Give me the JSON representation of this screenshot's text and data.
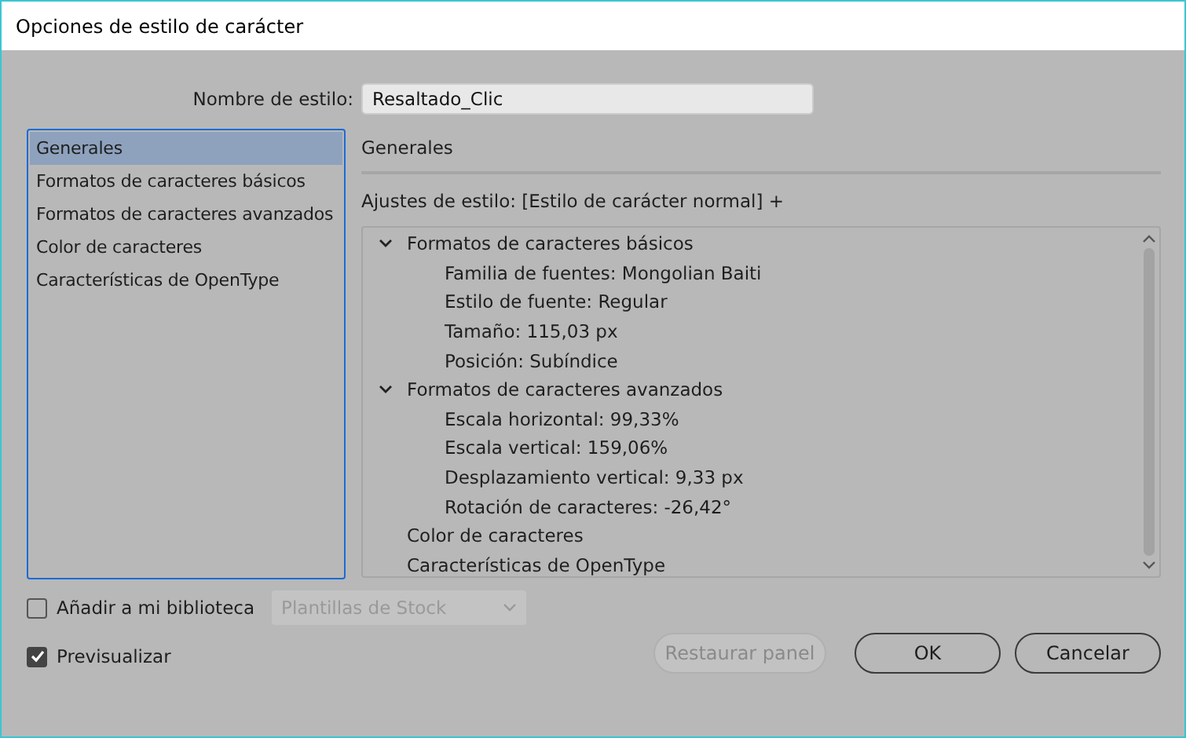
{
  "window": {
    "title": "Opciones de estilo de carácter"
  },
  "style_name": {
    "label": "Nombre de estilo:",
    "value": "Resaltado_Clic"
  },
  "sidebar": {
    "items": [
      {
        "label": "Generales",
        "selected": true
      },
      {
        "label": "Formatos de caracteres básicos",
        "selected": false
      },
      {
        "label": "Formatos de caracteres avanzados",
        "selected": false
      },
      {
        "label": "Color de caracteres",
        "selected": false
      },
      {
        "label": "Características de OpenType",
        "selected": false
      }
    ]
  },
  "panel": {
    "heading": "Generales",
    "settings": "Ajustes de estilo: [Estilo de carácter normal] +",
    "tree": [
      {
        "label": "Formatos de caracteres básicos",
        "expanded": true,
        "children": [
          {
            "label": "Familia de fuentes: Mongolian Baiti"
          },
          {
            "label": "Estilo de fuente: Regular"
          },
          {
            "label": "Tamaño: 115,03 px"
          },
          {
            "label": "Posición: Subíndice"
          }
        ]
      },
      {
        "label": "Formatos de caracteres avanzados",
        "expanded": true,
        "children": [
          {
            "label": "Escala horizontal: 99,33%"
          },
          {
            "label": "Escala vertical: 159,06%"
          },
          {
            "label": "Desplazamiento vertical: 9,33 px"
          },
          {
            "label": "Rotación de caracteres: -26,42°"
          }
        ]
      },
      {
        "label": "Color de caracteres"
      },
      {
        "label": "Características de OpenType"
      }
    ]
  },
  "library": {
    "label": "Añadir a mi biblioteca",
    "checked": false,
    "dropdown": "Plantillas de Stock",
    "disabled": true
  },
  "preview": {
    "label": "Previsualizar",
    "checked": true
  },
  "buttons": [
    {
      "label": "Restaurar panel",
      "disabled": true
    },
    {
      "label": "OK",
      "disabled": false
    },
    {
      "label": "Cancelar",
      "disabled": false
    }
  ]
}
